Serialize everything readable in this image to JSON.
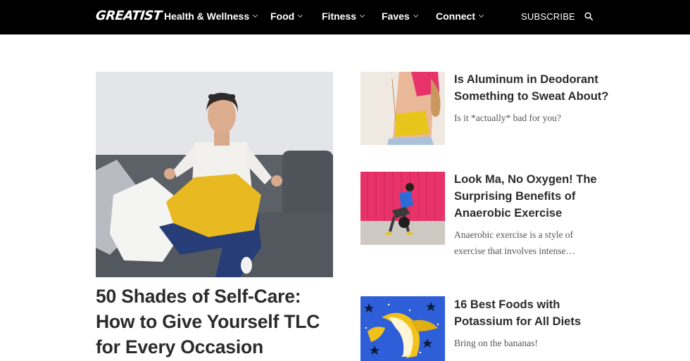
{
  "header": {
    "logo": "GREATIST",
    "nav": [
      {
        "label": "Health & Wellness"
      },
      {
        "label": "Food"
      },
      {
        "label": "Fitness"
      },
      {
        "label": "Faves"
      },
      {
        "label": "Connect"
      }
    ],
    "subscribe_label": "SUBSCRIBE",
    "search_icon": "search-icon"
  },
  "hero": {
    "title": "50 Shades of Self-Care: How to Give Yourself TLC for Every Occasion"
  },
  "articles": [
    {
      "title": "Is Aluminum in Deodorant Something to Sweat About?",
      "description": "Is it *actually* bad for you?"
    },
    {
      "title": "Look Ma, No Oxygen! The Surprising Benefits of Anaerobic Exercise",
      "description": "Anaerobic exercise is a style of exercise that involves intense…"
    },
    {
      "title": "16 Best Foods with Potassium for All Diets",
      "description": "Bring on the bananas!"
    }
  ],
  "colors": {
    "nav_bg": "#000000",
    "text": "#2b2b2b",
    "muted": "#555555",
    "accent_pink": "#e8336a",
    "accent_blue": "#2f5fd8",
    "accent_yellow": "#f2c21b"
  }
}
